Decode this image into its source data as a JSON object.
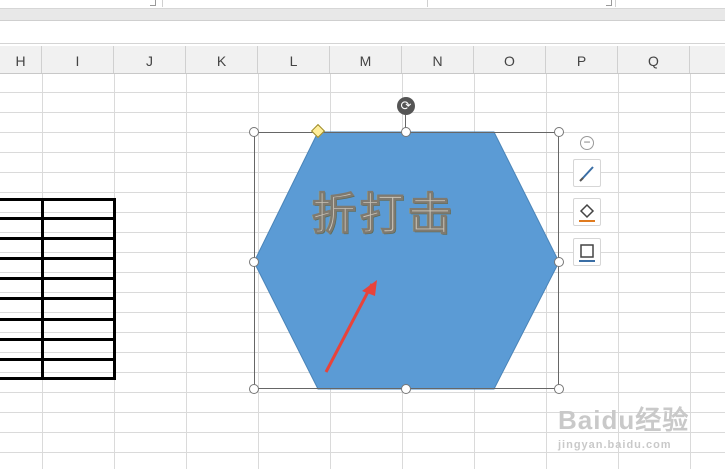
{
  "columns": [
    "H",
    "I",
    "J",
    "K",
    "L",
    "M",
    "N",
    "O",
    "P",
    "Q"
  ],
  "shape": {
    "text": "折打击",
    "fill": "#5b9bd5",
    "outline": "#4a84b8"
  },
  "annotation_arrow_color": "#e8433b",
  "toolbar": {
    "collapse_label": "−",
    "items": [
      "shape-style-icon",
      "fill-icon",
      "outline-icon"
    ]
  },
  "watermark": {
    "logo": "Baidu经验",
    "url": "jingyan.baidu.com"
  }
}
